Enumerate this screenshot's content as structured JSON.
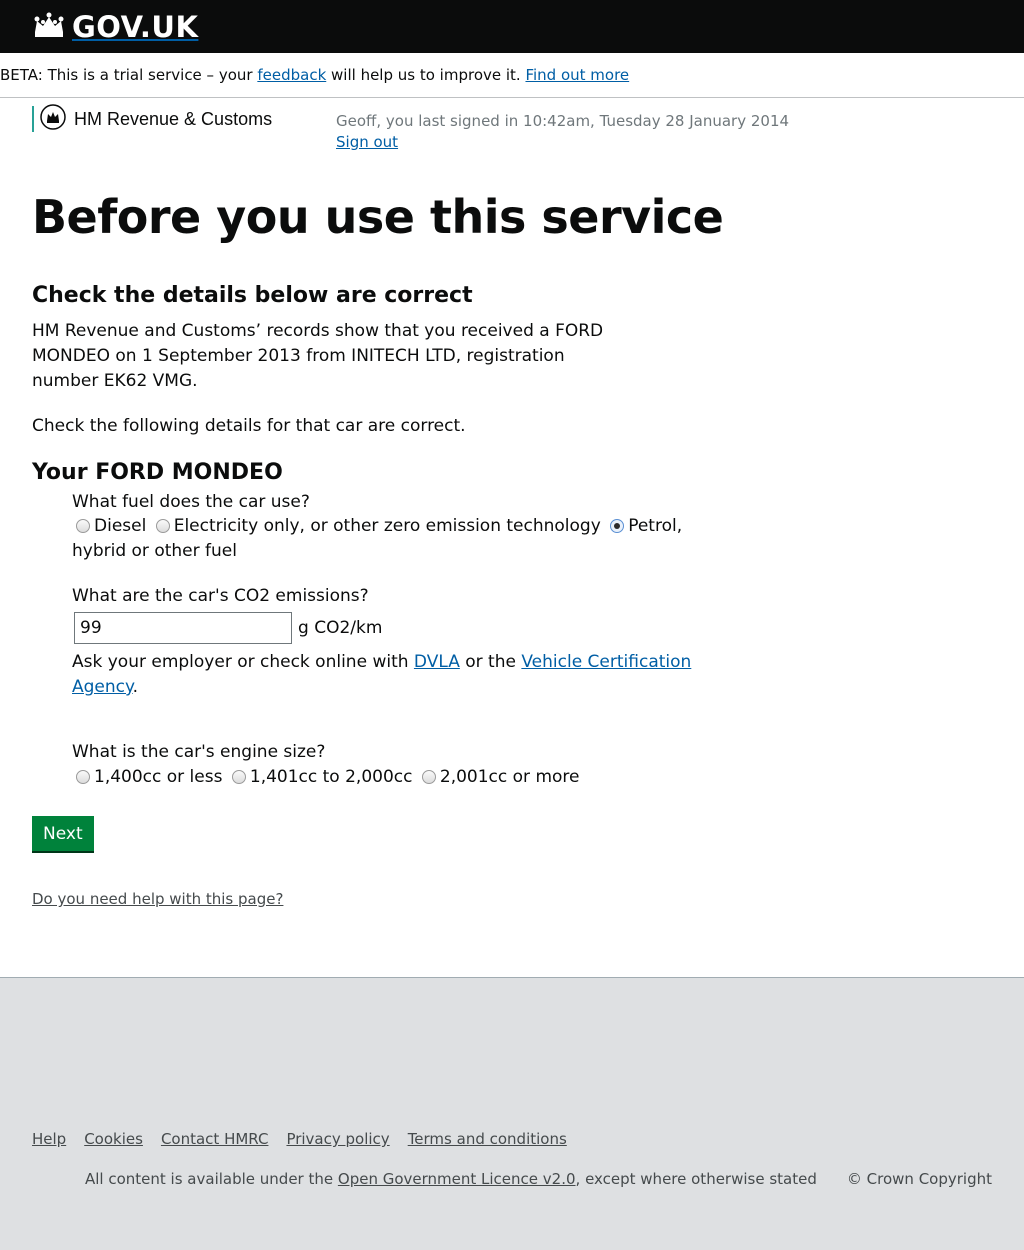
{
  "header": {
    "logo_text": "GOV.UK",
    "logo_icon": "crown-icon"
  },
  "beta_banner": {
    "prefix": "BETA: This is a trial service – your",
    "feedback_link": "feedback",
    "middle": "will help us to improve it.",
    "find_out_link": "Find out more"
  },
  "department": {
    "name": "HM Revenue & Customs",
    "icon": "crest-icon",
    "accent_color": "#28a197"
  },
  "user": {
    "last_signed_in": "Geoff, you last signed in 10:42am, Tuesday 28 January 2014",
    "sign_out": "Sign out"
  },
  "page": {
    "title": "Before you use this service",
    "subtitle": "Check the details below are correct",
    "intro": "HM Revenue and Customs’ records show that you received a FORD MONDEO on 1 September 2013 from INITECH LTD, registration number EK62 VMG.",
    "check_text": "Check the following details for that car are correct.",
    "car_heading": "Your FORD MONDEO"
  },
  "fuel": {
    "question": "What fuel does the car use?",
    "options": [
      "Diesel",
      "Electricity only, or other zero emission technology",
      "Petrol, hybrid or other fuel"
    ],
    "selected": "Petrol, hybrid or other fuel"
  },
  "co2": {
    "question": "What are the car's CO2 emissions?",
    "value": "99",
    "unit": "g CO2/km",
    "help_prefix": "Ask your employer or check online with",
    "dvla_link": "DVLA",
    "help_middle": "or the",
    "vca_link": "Vehicle Certification Agency",
    "help_suffix": "."
  },
  "engine": {
    "question": "What is the car's engine size?",
    "options": [
      "1,400cc or less",
      "1,401cc to 2,000cc",
      "2,001cc or more"
    ]
  },
  "actions": {
    "next_label": "Next",
    "help_link": "Do you need help with this page?",
    "button_color": "#00823b"
  },
  "footer": {
    "links": [
      "Help",
      "Cookies",
      "Contact HMRC",
      "Privacy policy",
      "Terms and conditions"
    ],
    "licence_prefix": "All content is available under the",
    "licence_link": "Open Government Licence v2.0",
    "licence_suffix": ", except where otherwise stated",
    "copyright": "© Crown Copyright"
  }
}
